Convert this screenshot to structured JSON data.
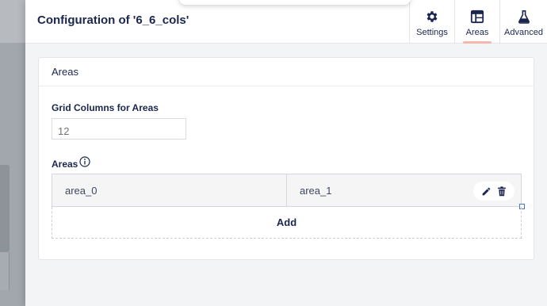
{
  "dialog": {
    "title": "Configuration of '6_6_cols'",
    "tabs": [
      {
        "label": "Settings",
        "icon": "gear-icon",
        "active": false
      },
      {
        "label": "Areas",
        "icon": "layout-icon",
        "active": true
      },
      {
        "label": "Advanced",
        "icon": "flask-icon",
        "active": false
      }
    ]
  },
  "panel": {
    "title": "Areas",
    "grid_columns": {
      "label": "Grid Columns for Areas",
      "placeholder": "12",
      "value": ""
    },
    "areas": {
      "label": "Areas",
      "info_icon": "info-icon",
      "items": [
        {
          "name": "area_0"
        },
        {
          "name": "area_1"
        }
      ],
      "add_label": "Add"
    }
  },
  "colors": {
    "text": "#1b264f",
    "active_tab_underline": "#f3b9b1",
    "backdrop": "#a2a6ad",
    "panel_bg": "#f3f4f6"
  }
}
